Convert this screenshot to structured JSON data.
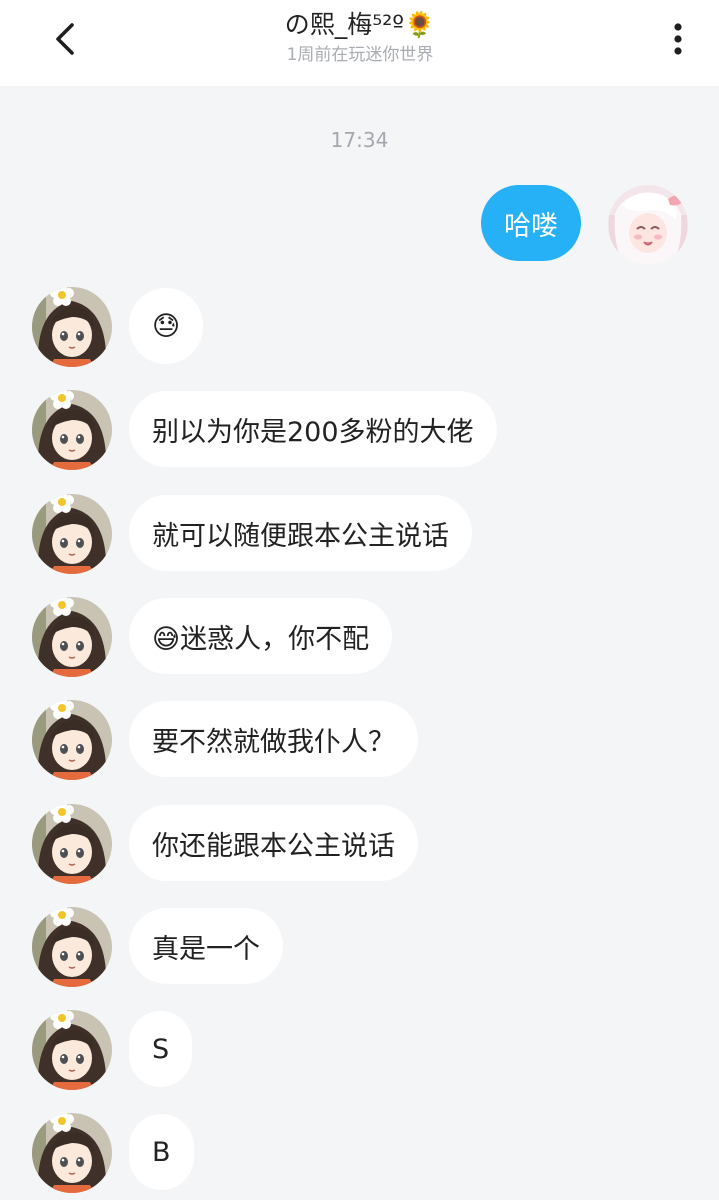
{
  "header": {
    "title": "の熙_梅⁵²º🌻",
    "subtitle": "1周前在玩迷你世界",
    "back_icon": "chevron-left-icon",
    "more_icon": "more-vertical-icon"
  },
  "chat": {
    "timestamp": "17:34",
    "outgoing": [
      {
        "text": "哈喽"
      }
    ],
    "incoming": [
      {
        "text": "😓"
      },
      {
        "text": "别以为你是200多粉的大佬"
      },
      {
        "text": "就可以随便跟本公主说话"
      },
      {
        "text": "😅迷惑人，你不配"
      },
      {
        "text": "要不然就做我仆人？"
      },
      {
        "text": "你还能跟本公主说话"
      },
      {
        "text": "真是一个"
      },
      {
        "text": "S"
      },
      {
        "text": "B"
      }
    ]
  },
  "colors": {
    "header_bg": "#ffffff",
    "page_bg": "#f4f5f7",
    "outgoing_bubble": "#26b0f5",
    "incoming_bubble": "#ffffff"
  }
}
